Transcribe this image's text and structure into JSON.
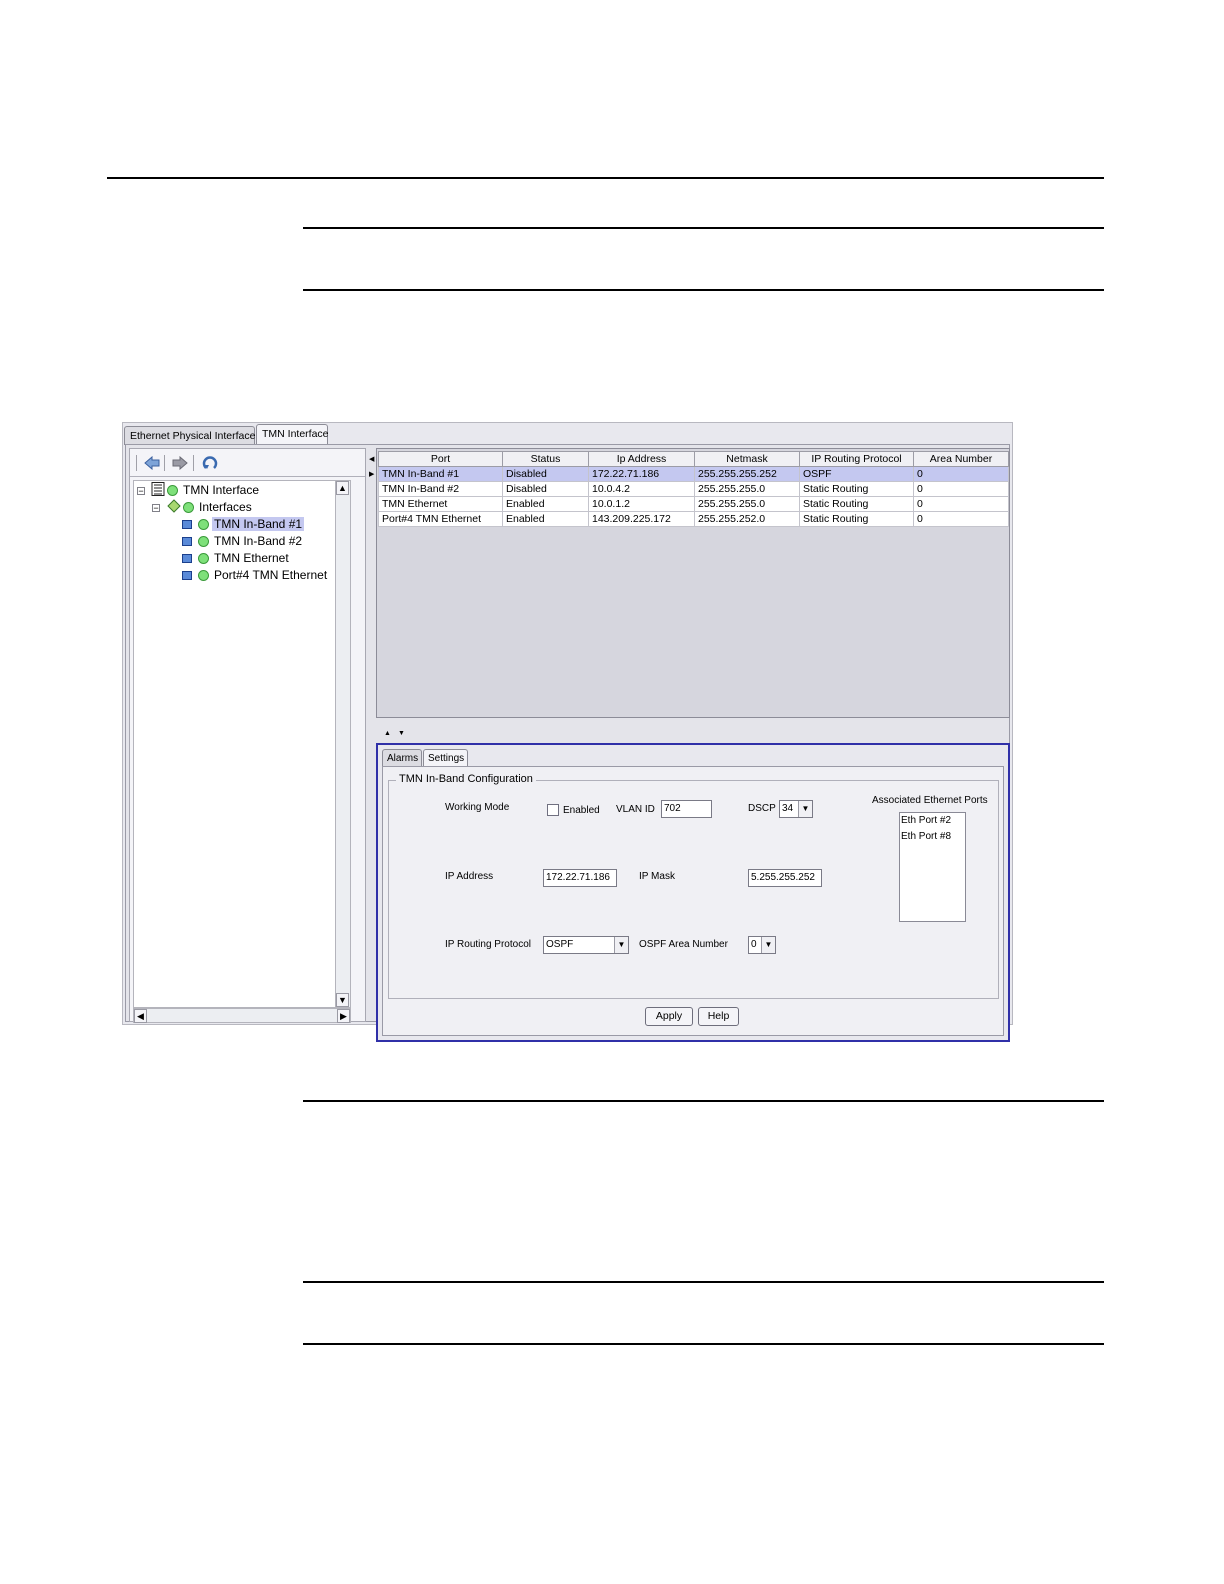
{
  "tabs": [
    "Ethernet Physical Interface",
    "TMN Interface"
  ],
  "tree": {
    "root": "TMN Interface",
    "group": "Interfaces",
    "items": [
      "TMN In-Band #1",
      "TMN In-Band #2",
      "TMN Ethernet",
      "Port#4 TMN Ethernet"
    ]
  },
  "table": {
    "headers": [
      "Port",
      "Status",
      "Ip Address",
      "Netmask",
      "IP Routing Protocol",
      "Area Number"
    ],
    "rows": [
      [
        "TMN In-Band #1",
        "Disabled",
        "172.22.71.186",
        "255.255.255.252",
        "OSPF",
        "0"
      ],
      [
        "TMN In-Band #2",
        "Disabled",
        "10.0.4.2",
        "255.255.255.0",
        "Static Routing",
        "0"
      ],
      [
        "TMN Ethernet",
        "Enabled",
        "10.0.1.2",
        "255.255.255.0",
        "Static Routing",
        "0"
      ],
      [
        "Port#4 TMN Ethernet",
        "Enabled",
        "143.209.225.172",
        "255.255.252.0",
        "Static Routing",
        "0"
      ]
    ]
  },
  "sub_tabs": [
    "Alarms",
    "Settings"
  ],
  "config": {
    "group_title": "TMN In-Band Configuration",
    "working_mode_label": "Working Mode",
    "enabled_label": "Enabled",
    "vlan_label": "VLAN ID",
    "vlan_value": "702",
    "dscp_label": "DSCP",
    "dscp_value": "34",
    "assoc_label": "Associated Ethernet Ports",
    "assoc_ports": [
      "Eth Port #2",
      "Eth Port #8"
    ],
    "ip_label": "IP Address",
    "ip_value": "172.22.71.186",
    "mask_label": "IP Mask",
    "mask_value": "5.255.255.252",
    "routing_label": "IP Routing Protocol",
    "routing_value": "OSPF",
    "area_label": "OSPF Area Number",
    "area_value": "0"
  },
  "buttons": {
    "apply": "Apply",
    "help": "Help"
  }
}
